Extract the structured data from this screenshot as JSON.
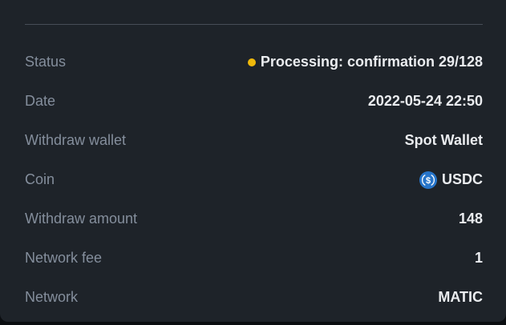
{
  "colors": {
    "panel_bg": "#1e2329",
    "label_text": "#848e9c",
    "value_text": "#eaecef",
    "status_pending": "#f0b90b",
    "usdc_blue": "#2775ca"
  },
  "details": {
    "status": {
      "label": "Status",
      "value": "Processing: confirmation 29/128"
    },
    "date": {
      "label": "Date",
      "value": "2022-05-24 22:50"
    },
    "wallet": {
      "label": "Withdraw wallet",
      "value": "Spot Wallet"
    },
    "coin": {
      "label": "Coin",
      "value": "USDC",
      "icon": "usdc-icon"
    },
    "amount": {
      "label": "Withdraw amount",
      "value": "148"
    },
    "fee": {
      "label": "Network fee",
      "value": "1"
    },
    "network": {
      "label": "Network",
      "value": "MATIC"
    }
  }
}
